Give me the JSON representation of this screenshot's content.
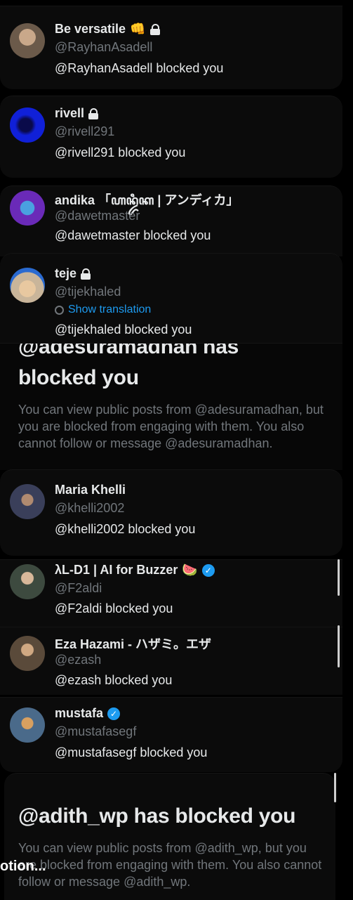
{
  "notifications": [
    {
      "name": "Be versatile",
      "emoji": "👊",
      "locked": true,
      "verified": false,
      "handle": "@RayhanAsadell",
      "message": "@RayhanAsadell blocked you",
      "avatar_color": "#6b5a4a"
    },
    {
      "name": "rivell",
      "emoji": "",
      "locked": true,
      "verified": false,
      "handle": "@rivell291",
      "message": "@rivell291 blocked you",
      "avatar_color": "#1020d8"
    },
    {
      "name": "andika 「ꦲꦤ꧀ꦢꦶꦏ | アンディカ」",
      "emoji": "",
      "locked": false,
      "verified": false,
      "handle": "@dawetmaster",
      "message": "@dawetmaster blocked you",
      "avatar_color": "#6a2ab8"
    },
    {
      "name": "teje",
      "emoji": "",
      "locked": true,
      "verified": false,
      "handle": "@tijekhaled",
      "translate": "Show translation",
      "message": "@tijekhaled blocked you",
      "avatar_color": "#c9b59a"
    },
    {
      "name": "Maria Khelli",
      "emoji": "",
      "locked": false,
      "verified": false,
      "handle": "@khelli2002",
      "message": "@khelli2002 blocked you",
      "avatar_color": "#3a3f5a"
    },
    {
      "name": "λL-D1 | AI for Buzzer",
      "emoji": "🍉",
      "locked": false,
      "verified": true,
      "handle": "@F2aldi",
      "message": "@F2aldi blocked you",
      "avatar_color": "#3d4a3f"
    },
    {
      "name": "Eza Hazami - ハザミ。エザ",
      "emoji": "",
      "locked": false,
      "verified": false,
      "handle": "@ezash",
      "message": "@ezash blocked you",
      "avatar_color": "#5a4a3a"
    },
    {
      "name": "mustafa",
      "emoji": "",
      "locked": false,
      "verified": true,
      "handle": "@mustafasegf",
      "message": "@mustafasegf blocked you",
      "avatar_color": "#4a6a8a"
    }
  ],
  "block_panels": [
    {
      "title_partial": "@adesuramadhan has",
      "title": "blocked you",
      "description": "You can view public posts from @adesuramadhan, but you are blocked from engaging with them. You also cannot follow or message @adesuramadhan."
    },
    {
      "title": "@adith_wp has blocked you",
      "description": "You can view public posts from @adith_wp, but you are blocked from engaging with them. You also cannot follow or message @adith_wp."
    }
  ],
  "toast": {
    "text": "otion..."
  }
}
